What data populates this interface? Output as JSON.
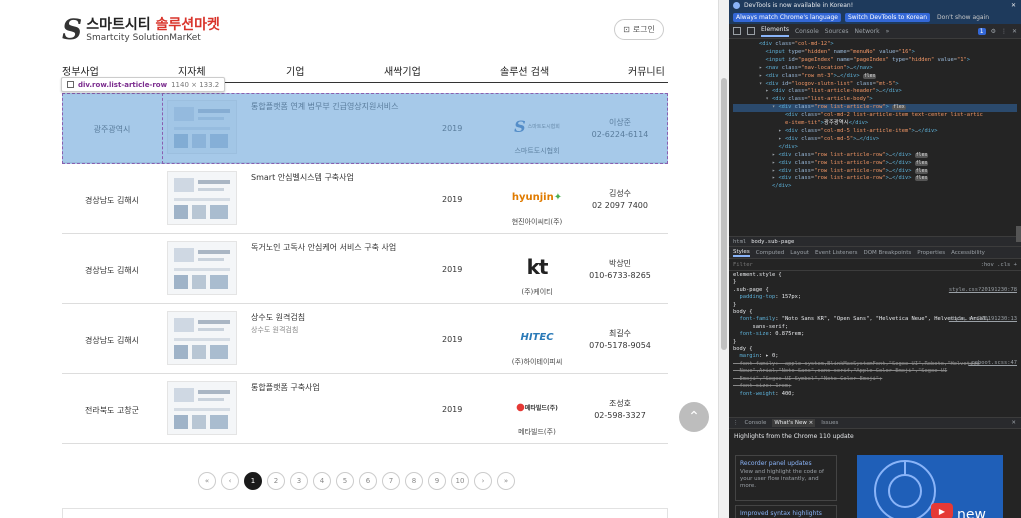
{
  "site": {
    "logo_mark": "S",
    "logo_ko_prefix": "스마트시티 ",
    "logo_ko_accent": "솔루션마켓",
    "logo_en": "Smartcity SolutionMarKet",
    "login_label": "로그인",
    "login_icon": "door-icon",
    "nav": [
      "정부사업",
      "지자체",
      "기업",
      "새싹기업",
      "솔루션 검색",
      "커뮤니티"
    ],
    "colors": {
      "accent": "#d9342b",
      "highlight": "#6fa8dc"
    }
  },
  "tooltip": {
    "selector": "div.row.list-article-row",
    "dims": "1140 × 133.2"
  },
  "rows": [
    {
      "region": "광주광역시",
      "title": "통합플랫폼 연계 법무부 긴급영상지원서비스",
      "sub": "",
      "year": "2019",
      "logo_text": "스마트도시협회",
      "logo_kind": "s-logo",
      "company": "스마트도시협회",
      "contact_name": "이상준",
      "contact_phone": "02-6224-6114"
    },
    {
      "region": "경상남도 김해시",
      "title": "Smart 안심벨시스템 구축사업",
      "sub": "",
      "year": "2019",
      "logo_text": "hyunjin",
      "logo_kind": "hyunjin",
      "company": "현진아이씨티(주)",
      "contact_name": "김성수",
      "contact_phone": "02 2097 7400"
    },
    {
      "region": "경상남도 김해시",
      "title": "독거노인 고독사 안심케어 서비스 구축 사업",
      "sub": "",
      "year": "2019",
      "logo_text": "kt",
      "logo_kind": "kt",
      "company": "(주)케이티",
      "contact_name": "박상민",
      "contact_phone": "010-6733-8265"
    },
    {
      "region": "경상남도 김해시",
      "title": "상수도 원격검침",
      "sub": "상수도 원격검침",
      "year": "2019",
      "logo_text": "HITEC",
      "logo_kind": "hitec",
      "company": "(주)하이테이피씨",
      "contact_name": "최길수",
      "contact_phone": "070-5178-9054"
    },
    {
      "region": "전라북도 고창군",
      "title": "통합플랫폼 구축사업",
      "sub": "",
      "year": "2019",
      "logo_text": "메타빌드(주)",
      "logo_kind": "metabuild",
      "company": "메타빌드(주)",
      "contact_name": "조성호",
      "contact_phone": "02-598-3327"
    }
  ],
  "pager": {
    "first": "«",
    "prev": "‹",
    "pages": [
      "1",
      "2",
      "3",
      "4",
      "5",
      "6",
      "7",
      "8",
      "9",
      "10"
    ],
    "current": "1",
    "next": "›",
    "last": "»"
  },
  "scroll_top_icon": "chevron-up-icon",
  "devtools": {
    "info_text": "DevTools is now available in Korean!",
    "btn_match": "Always match Chrome's language",
    "btn_switch": "Switch DevTools to Korean",
    "btn_dont": "Don't show again",
    "tabs": [
      "Elements",
      "Console",
      "Sources",
      "Network",
      "»"
    ],
    "badge": "1",
    "breadcrumb": [
      "html",
      "body.sub-page"
    ],
    "style_tabs": [
      "Styles",
      "Computed",
      "Layout",
      "Event Listeners",
      "DOM Breakpoints",
      "Properties",
      "Accessibility"
    ],
    "filter_placeholder": "Filter",
    "filter_right": ":hov  .cls  +",
    "drawer_tabs": [
      "Console",
      "What's New ×",
      "Issues"
    ],
    "whatsnew_head": "Highlights from the Chrome 110 update",
    "card1_title": "Recorder panel updates",
    "card1_desc": "View and highlight the code of your user flow instantly, and more.",
    "card2_title": "Improved syntax highlights",
    "video_word": "new"
  }
}
